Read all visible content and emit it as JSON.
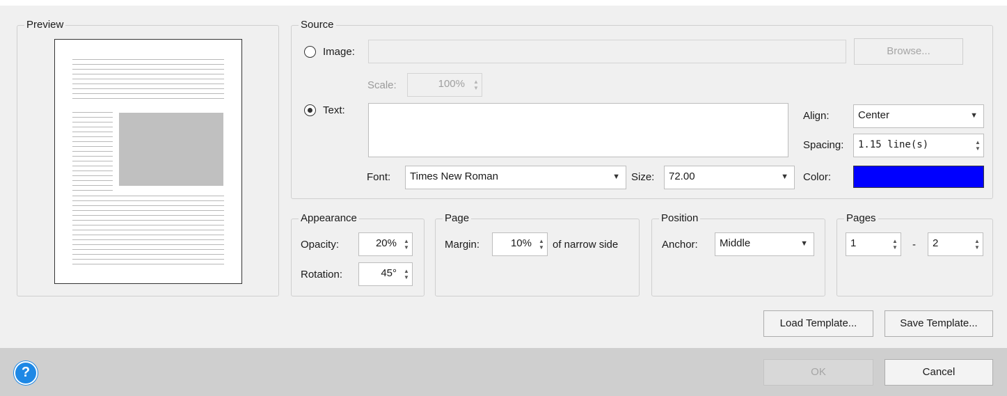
{
  "preview": {
    "legend": "Preview"
  },
  "source": {
    "legend": "Source",
    "image_label": "Image:",
    "image_path": "",
    "browse_label": "Browse...",
    "scale_label": "Scale:",
    "scale_value": "100%",
    "text_label": "Text:",
    "text_value": "",
    "align_label": "Align:",
    "align_value": "Center",
    "spacing_label": "Spacing:",
    "spacing_value": "1.15  line(s)",
    "font_label": "Font:",
    "font_value": "Times New Roman",
    "size_label": "Size:",
    "size_value": "72.00",
    "color_label": "Color:",
    "color_value": "#0000ff",
    "selected_source": "text"
  },
  "appearance": {
    "legend": "Appearance",
    "opacity_label": "Opacity:",
    "opacity_value": "20%",
    "rotation_label": "Rotation:",
    "rotation_value": "45°"
  },
  "page": {
    "legend": "Page",
    "margin_label": "Margin:",
    "margin_value": "10%",
    "margin_suffix": "of narrow side"
  },
  "position": {
    "legend": "Position",
    "anchor_label": "Anchor:",
    "anchor_value": "Middle"
  },
  "pages": {
    "legend": "Pages",
    "from_value": "1",
    "separator": "-",
    "to_value": "2"
  },
  "buttons": {
    "load_template": "Load Template...",
    "save_template": "Save Template...",
    "ok": "OK",
    "cancel": "Cancel"
  },
  "icons": {
    "help": "help-icon",
    "help_glyph": "?"
  },
  "colors": {
    "footer": "#cfcfcf",
    "accent": "#1e88e5",
    "watermark_color": "#0000ff"
  }
}
